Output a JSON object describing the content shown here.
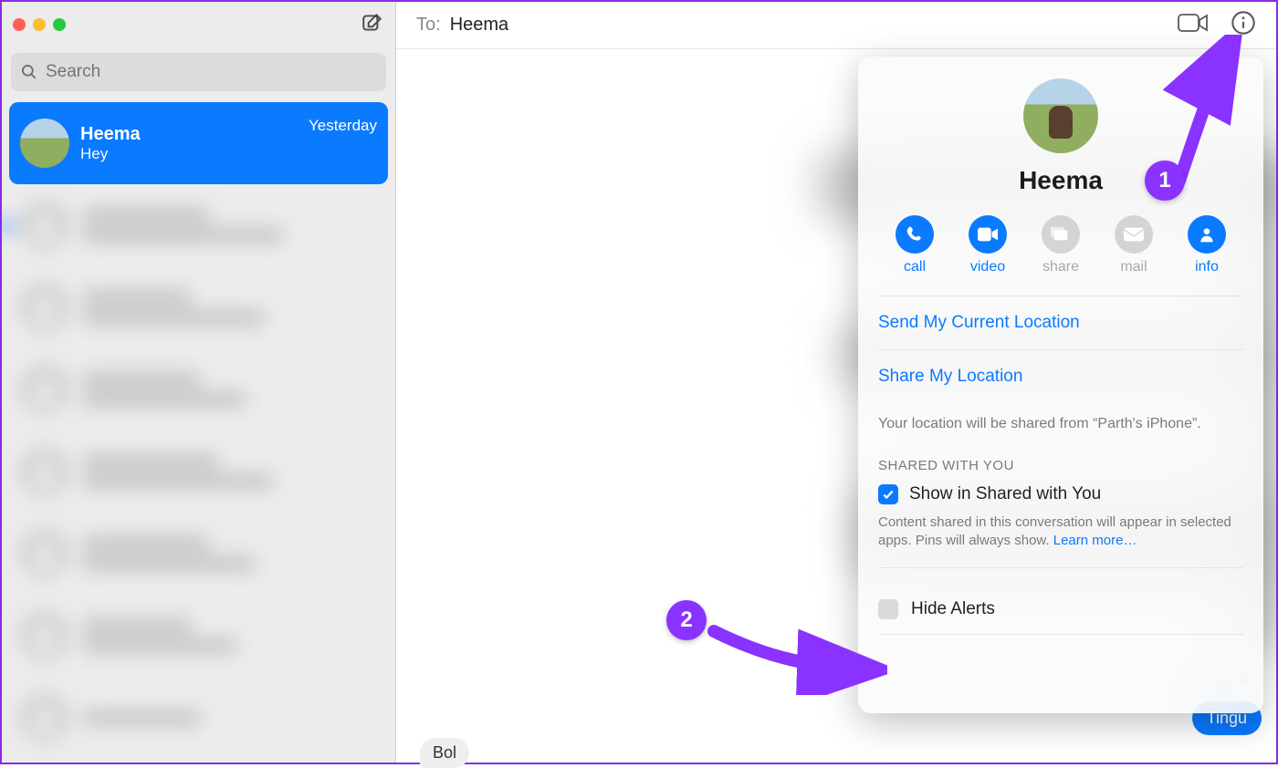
{
  "sidebar": {
    "search_placeholder": "Search",
    "selected": {
      "name": "Heema",
      "preview": "Hey",
      "time": "Yesterday"
    }
  },
  "topbar": {
    "to_label": "To:",
    "to_name": "Heema"
  },
  "chat": {
    "day_label": "Yesterday, 9",
    "outgoing_bubble": "Tingu",
    "typing_preview": "Bol"
  },
  "popover": {
    "name": "Heema",
    "actions": {
      "call": "call",
      "video": "video",
      "share": "share",
      "mail": "mail",
      "info": "info"
    },
    "send_location": "Send My Current Location",
    "share_location": "Share My Location",
    "location_hint": "Your location will be shared from “Parth's iPhone”.",
    "shared_header": "SHARED WITH YOU",
    "shared_checkbox": "Show in Shared with You",
    "shared_desc": "Content shared in this conversation will appear in selected apps. Pins will always show. ",
    "learn_more": "Learn more…",
    "hide_alerts": "Hide Alerts"
  },
  "annotations": {
    "one": "1",
    "two": "2"
  }
}
